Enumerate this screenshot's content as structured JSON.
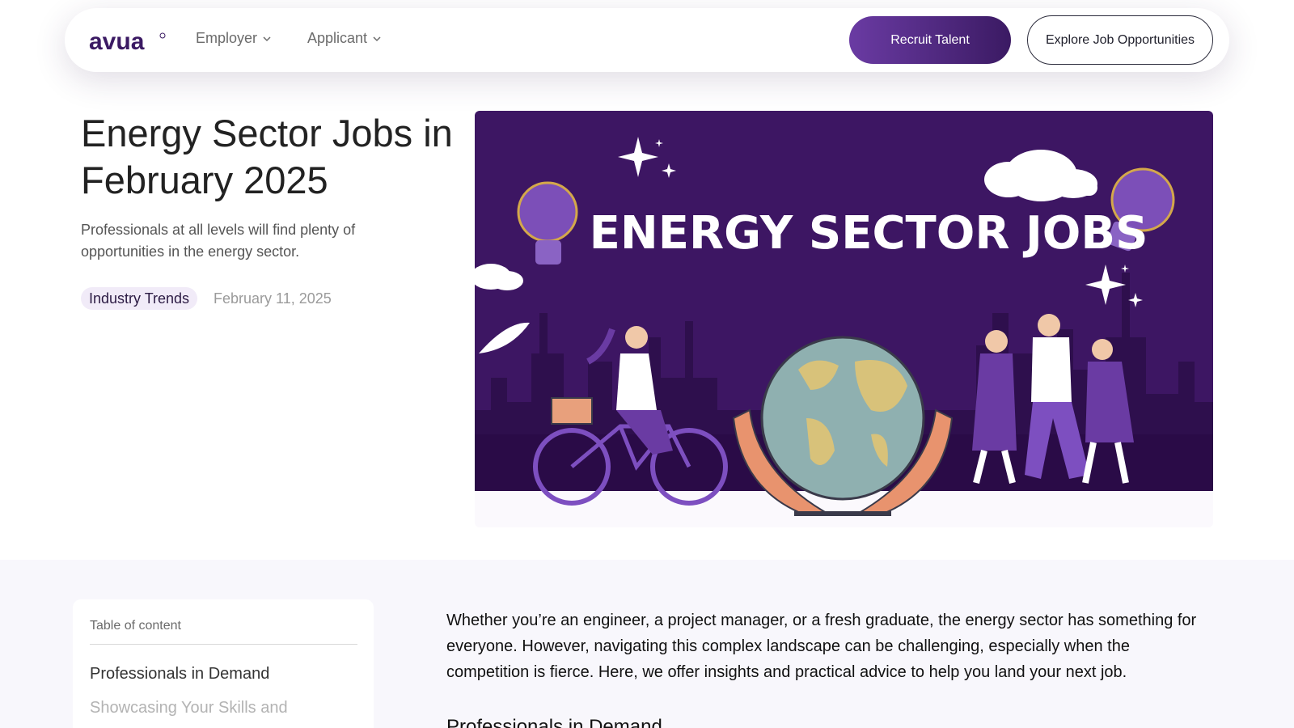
{
  "nav": {
    "logo": "avua",
    "employer_label": "Employer",
    "applicant_label": "Applicant",
    "recruit_label": "Recruit Talent",
    "explore_label": "Explore Job Opportunities"
  },
  "hero": {
    "title": "Energy Sector Jobs in February 2025",
    "subtitle": "Professionals at all levels will find plenty of opportunities in the energy sector.",
    "tag": "Industry Trends",
    "date": "February 11, 2025",
    "image_text": "ENERGY SECTOR JOBS"
  },
  "toc": {
    "heading": "Table of content",
    "items": [
      "Professionals in Demand",
      "Showcasing Your Skills and"
    ]
  },
  "article": {
    "intro": "Whether you’re an engineer, a project manager, or a fresh graduate, the energy sector has something for everyone. However, navigating this complex landscape can be challenging, especially when the competition is fierce. Here, we offer insights and practical advice to help you land your next job.",
    "heading": "Professionals in Demand"
  },
  "colors": {
    "brand_purple": "#3b1a63",
    "accent_purple": "#6a3ba3",
    "hero_bg": "#3d1663",
    "tag_bg": "#f1ebf8"
  },
  "icons": [
    "chevron-down-icon",
    "lightbulb-icon",
    "globe-icon",
    "sparkle-icon",
    "cloud-icon"
  ]
}
